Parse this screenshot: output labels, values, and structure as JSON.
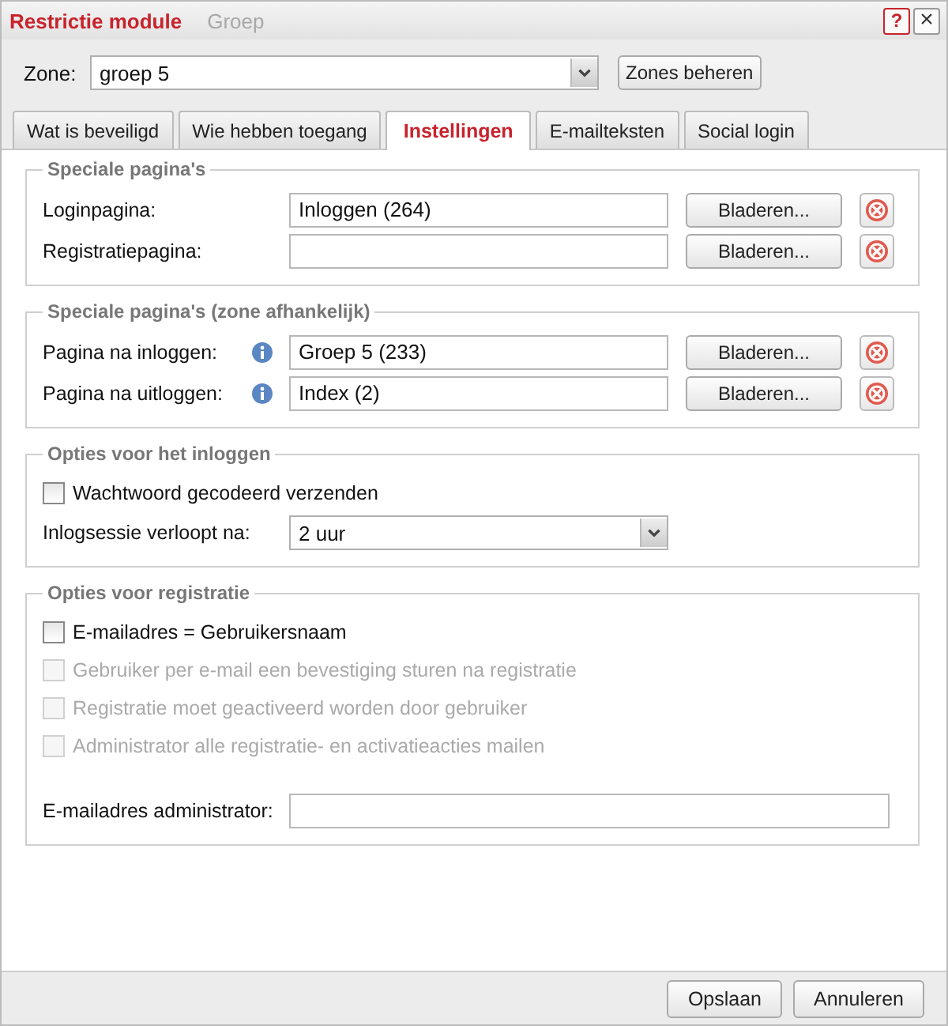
{
  "window": {
    "title": "Restrictie module",
    "background_text": "Groep",
    "help_button": "?",
    "close_button": "×"
  },
  "zone": {
    "label": "Zone:",
    "value": "groep 5",
    "manage_button": "Zones beheren"
  },
  "tabs": [
    {
      "label": "Wat is beveiligd",
      "selected": false
    },
    {
      "label": "Wie hebben toegang",
      "selected": false
    },
    {
      "label": "Instellingen",
      "selected": true
    },
    {
      "label": "E-mailteksten",
      "selected": false
    },
    {
      "label": "Social login",
      "selected": false
    }
  ],
  "sections": [
    {
      "title": "Speciale pagina's",
      "rows": [
        {
          "kind": "page",
          "label": "Loginpagina:",
          "info": false,
          "value": "Inloggen (264)",
          "button": "Bladeren..."
        },
        {
          "kind": "page",
          "label": "Registratiepagina:",
          "info": false,
          "button": "Bladeren..."
        }
      ]
    },
    {
      "title": "Speciale pagina's (zone afhankelijk)",
      "rows": [
        {
          "kind": "page",
          "label": "Pagina na inloggen:",
          "info": true,
          "value": "Groep 5 (233)",
          "button": "Bladeren..."
        },
        {
          "kind": "page",
          "label": "Pagina na uitloggen:",
          "info": true,
          "value": "Index (2)",
          "button": "Bladeren..."
        }
      ]
    },
    {
      "title": "Opties voor het inloggen",
      "rows": [
        {
          "kind": "checkbox",
          "label": "Wachtwoord gecodeerd verzenden",
          "checked": false,
          "disabled": false
        },
        {
          "kind": "select",
          "label": "Inlogsessie verloopt na:",
          "value": "2 uur"
        }
      ]
    },
    {
      "title": "Opties voor registratie",
      "rows": [
        {
          "kind": "checkbox",
          "label": "E-mailadres = Gebruikersnaam",
          "checked": false,
          "disabled": false
        },
        {
          "kind": "checkbox",
          "label": "Gebruiker per e-mail een bevestiging sturen na registratie",
          "checked": false,
          "disabled": true
        },
        {
          "kind": "checkbox",
          "label": "Registratie moet geactiveerd worden door gebruiker",
          "checked": false,
          "disabled": true
        },
        {
          "kind": "checkbox",
          "label": "Administrator alle registratie- en activatieacties mailen",
          "checked": false,
          "disabled": true
        },
        {
          "kind": "spacer"
        },
        {
          "kind": "text",
          "label": "E-mailadres administrator:"
        }
      ]
    }
  ],
  "buttons": [
    "Opslaan",
    "Annuleren"
  ]
}
